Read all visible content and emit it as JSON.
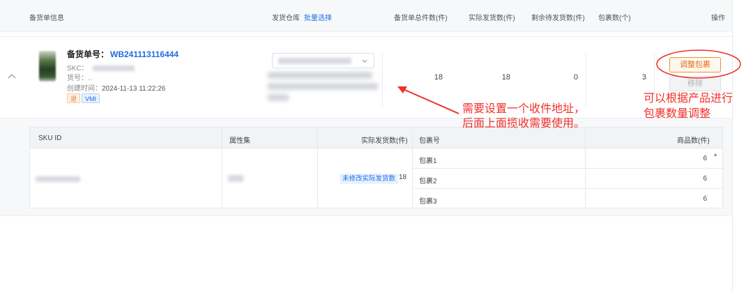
{
  "table_header": {
    "info": "备货单信息",
    "warehouse": "发货仓库",
    "batch_select": "批量选择",
    "total_items": "备货单总件数(件)",
    "actual_shipped": "实际发货数(件)",
    "remaining": "剩余待发货数(件)",
    "packages": "包裹数(个)",
    "action": "操作"
  },
  "order": {
    "number_label": "备货单号：",
    "number": "WB241113116444",
    "skc_label": "SKC：",
    "item_no_label": "货号：",
    "item_no_value": "..",
    "created_label": "创建时间：",
    "created_time": "2024-11-13 11:22:26",
    "tag_return": "退",
    "tag_vmi": "VMI",
    "total": "18",
    "actual": "18",
    "remaining": "0",
    "packages": "3",
    "adjust_button": "调整包裹",
    "remove_button": "移除"
  },
  "sub_table": {
    "headers": {
      "sku_id": "SKU ID",
      "attributes": "属性集",
      "actual_shipped": "实际发货数(件)",
      "package_no": "包裹号",
      "item_count": "商品数(件)"
    },
    "status_badge": "未修改实际发货数",
    "shipped_qty": "18",
    "packages": [
      {
        "name": "包裹1",
        "qty": "6"
      },
      {
        "name": "包裹2",
        "qty": "6"
      },
      {
        "name": "包裹3",
        "qty": "6"
      }
    ]
  },
  "annotations": {
    "address_line1": "需要设置一个收件地址，",
    "address_line2": "后面上面揽收需要使用。",
    "package_line1": "可以根据产品进行",
    "package_line2": "包裹数量调整"
  },
  "colors": {
    "accent": "#1f6fe0",
    "annotation": "#f0302a",
    "adjust_button": "#e0701a"
  }
}
